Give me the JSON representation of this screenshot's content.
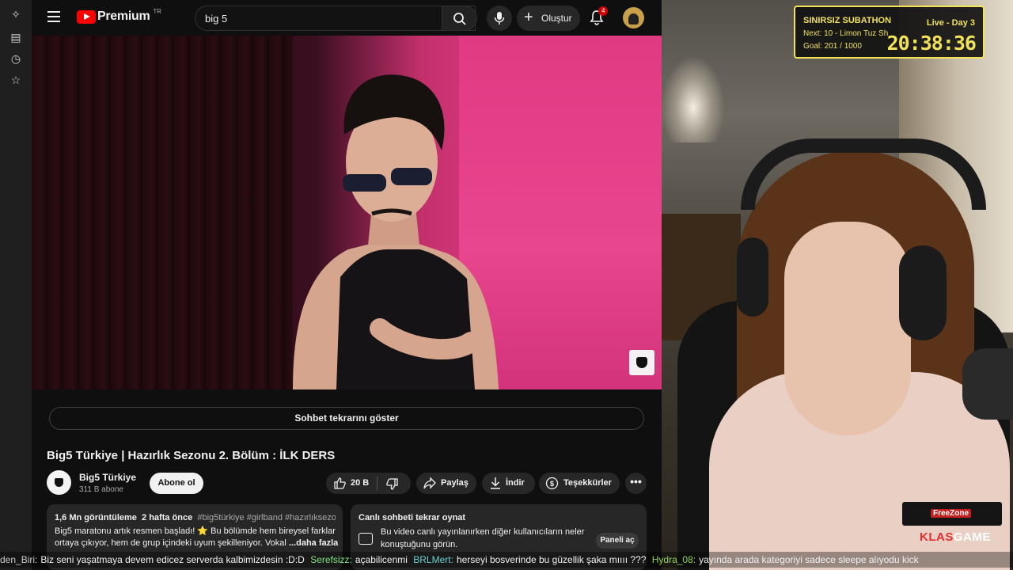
{
  "header": {
    "brand": "Premium",
    "region": "TR",
    "search_query": "big 5",
    "create_label": "Oluştur",
    "notifications_count": "4"
  },
  "video": {
    "chat_replay_label": "Sohbet tekrarını göster",
    "title": "Big5 Türkiye | Hazırlık Sezonu 2. Bölüm : İLK DERS",
    "channel_name": "Big5 Türkiye",
    "subscribers": "311 B abone",
    "subscribe_label": "Abone ol",
    "likes": "20 B",
    "share_label": "Paylaş",
    "download_label": "İndir",
    "thanks_label": "Teşekkürler",
    "more_label": "•••"
  },
  "description": {
    "views": "1,6 Mn görüntüleme",
    "age": "2 hafta önce",
    "tags": "#big5türkiye #girlband #hazırlıksezo",
    "line1": "Big5 maratonu artık resmen başladı! ⭐ Bu bölümde hem bireysel farklar",
    "line2": "ortaya çıkıyor, hem de grup içindeki uyum şekilleniyor. Vokal",
    "more": "...daha fazla"
  },
  "live_chat": {
    "heading": "Canlı sohbeti tekrar oynat",
    "body1": "Bu video canlı yayınlanırken diğer kullanıcıların neler",
    "body2": "konuştuğunu görün.",
    "panel_button": "Paneli aç"
  },
  "subathon": {
    "title": "SINIRSIZ SUBATHON",
    "next": "Next: 10 - Limon Tuz Sh",
    "goal": "Goal: 201 / 1000",
    "live": "Live - Day 3",
    "timer": "20:38:36"
  },
  "sponsors": {
    "freezone": "FreeZone",
    "klas_a": "KLAS",
    "klas_b": "GAME"
  },
  "ticker": [
    {
      "name": "den_Biri:",
      "msg": "Biz seni yaşatmaya devem edicez serverda kalbimizdesin :D:D"
    },
    {
      "name": "Serefsizz:",
      "msg": "açabilicenmi"
    },
    {
      "name": "BRLMert:",
      "msg": "herseyi bosverinde bu güzellik şaka mıııı ???"
    },
    {
      "name": "Hydra_08:",
      "msg": "yayında arada kategoriyi sadece sleepe alıyodu kick"
    }
  ],
  "colors": {
    "accent_red": "#ff0000",
    "subathon_yellow": "#f2e25a"
  }
}
